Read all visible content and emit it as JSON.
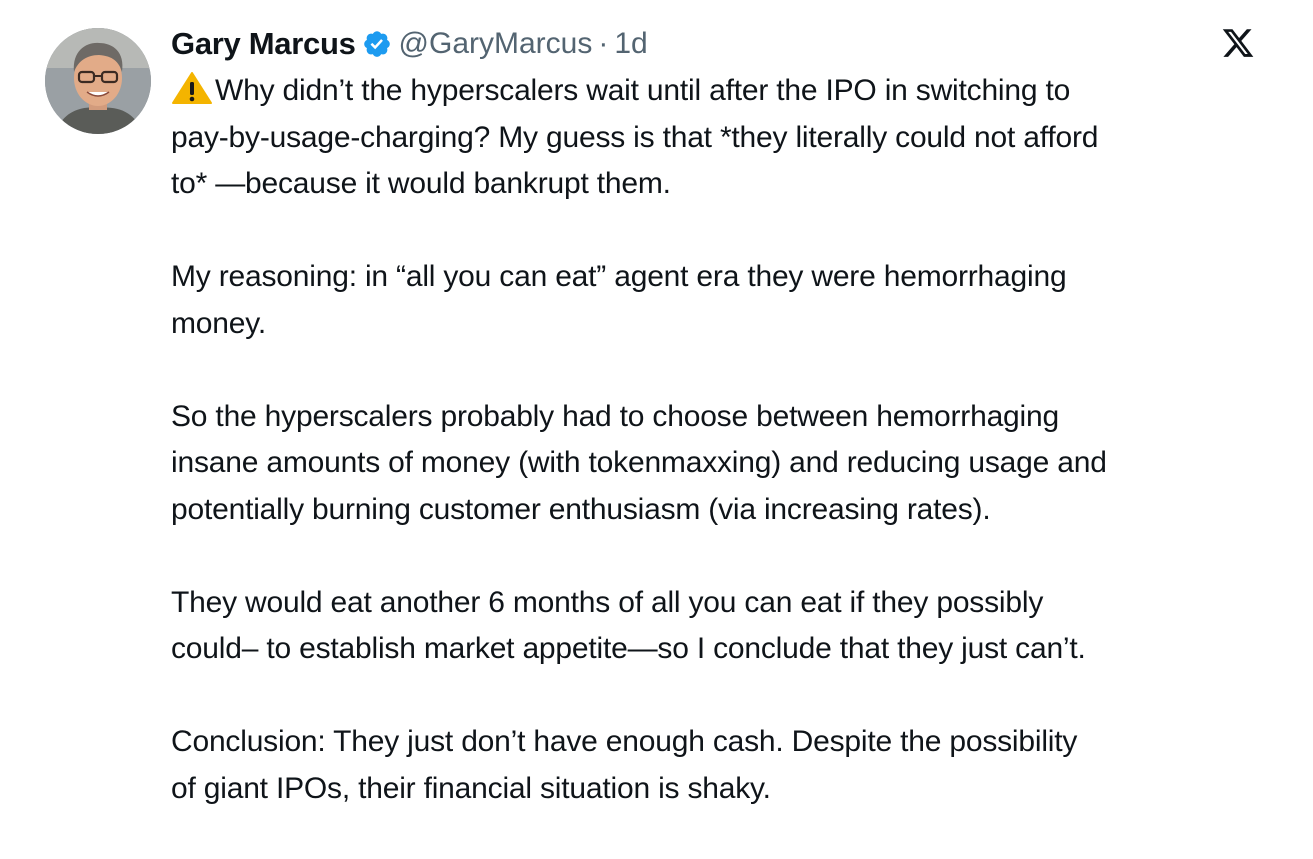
{
  "author": {
    "name": "Gary Marcus",
    "handle": "@GaryMarcus",
    "separator": "·",
    "time": "1d",
    "verified_icon": "verified-badge-icon",
    "avatar_icon": "avatar-photo"
  },
  "platform": {
    "logo_icon": "x-logo-icon"
  },
  "colors": {
    "text": "#0f1419",
    "muted": "#536471",
    "verified": "#1d9bf0",
    "warning": "#f4b400"
  },
  "tweet": {
    "lead_icon": "warning-icon",
    "paragraphs": [
      "Why didn’t the hyperscalers wait until after the IPO in switching to\npay-by-usage-charging? My guess is that *they literally could not afford\nto* —because it would bankrupt them.",
      "My reasoning: in “all you can eat”  agent era they were hemorrhaging\nmoney.",
      "So the hyperscalers probably had to choose between hemorrhaging\ninsane amounts of money (with tokenmaxxing) and reducing usage and\npotentially burning customer enthusiasm (via increasing rates).",
      "They would eat another 6 months of all you can eat if they possibly\ncould– to establish market appetite—so I conclude that they just can’t.",
      "Conclusion: They just don’t have enough cash. Despite the possibility\nof giant IPOs, their financial situation is shaky."
    ]
  }
}
